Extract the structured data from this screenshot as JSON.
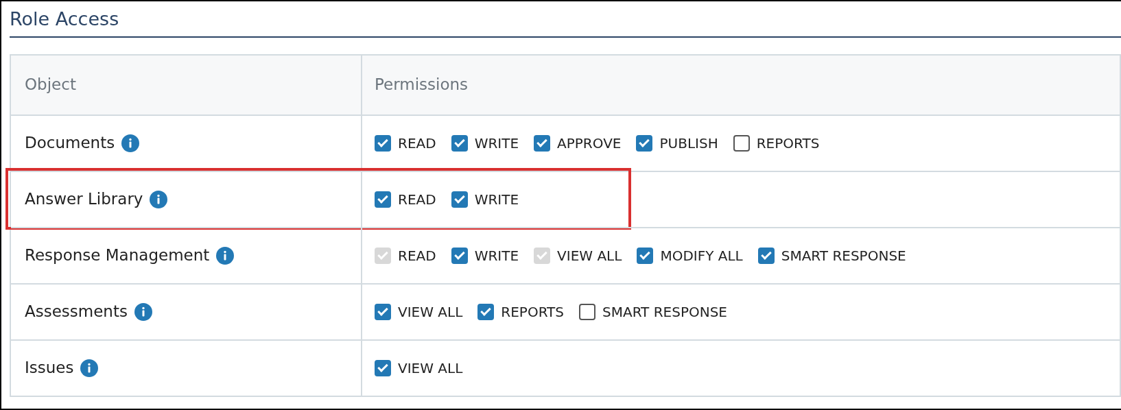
{
  "title": "Role Access",
  "table": {
    "columns": [
      "Object",
      "Permissions"
    ],
    "rows": [
      {
        "object": "Documents",
        "highlighted": false,
        "permissions": [
          {
            "label": "READ",
            "checked": true,
            "disabled": false
          },
          {
            "label": "WRITE",
            "checked": true,
            "disabled": false
          },
          {
            "label": "APPROVE",
            "checked": true,
            "disabled": false
          },
          {
            "label": "PUBLISH",
            "checked": true,
            "disabled": false
          },
          {
            "label": "REPORTS",
            "checked": false,
            "disabled": false
          }
        ]
      },
      {
        "object": "Answer Library",
        "highlighted": true,
        "permissions": [
          {
            "label": "READ",
            "checked": true,
            "disabled": false
          },
          {
            "label": "WRITE",
            "checked": true,
            "disabled": false
          }
        ]
      },
      {
        "object": "Response Management",
        "highlighted": false,
        "permissions": [
          {
            "label": "READ",
            "checked": true,
            "disabled": true
          },
          {
            "label": "WRITE",
            "checked": true,
            "disabled": false
          },
          {
            "label": "VIEW ALL",
            "checked": true,
            "disabled": true
          },
          {
            "label": "MODIFY ALL",
            "checked": true,
            "disabled": false
          },
          {
            "label": "SMART RESPONSE",
            "checked": true,
            "disabled": false
          }
        ]
      },
      {
        "object": "Assessments",
        "highlighted": false,
        "permissions": [
          {
            "label": "VIEW ALL",
            "checked": true,
            "disabled": false
          },
          {
            "label": "REPORTS",
            "checked": true,
            "disabled": false
          },
          {
            "label": "SMART RESPONSE",
            "checked": false,
            "disabled": false
          }
        ]
      },
      {
        "object": "Issues",
        "highlighted": false,
        "permissions": [
          {
            "label": "VIEW ALL",
            "checked": true,
            "disabled": false
          }
        ]
      }
    ]
  }
}
